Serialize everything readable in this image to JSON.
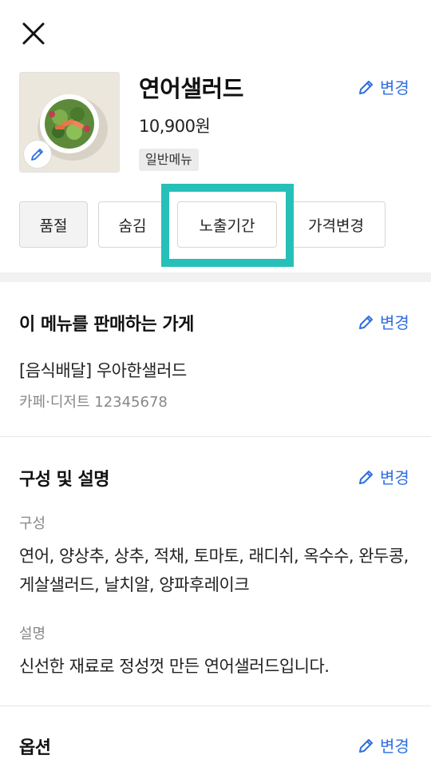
{
  "header": {
    "menu_name": "연어샐러드",
    "price": "10,900원",
    "tag": "일반메뉴",
    "edit_label": "변경"
  },
  "actions": [
    {
      "label": "품절"
    },
    {
      "label": "숨김"
    },
    {
      "label": "노출기간",
      "highlighted": true
    },
    {
      "label": "가격변경"
    }
  ],
  "stores_section": {
    "title": "이 메뉴를 판매하는 가게",
    "edit_label": "변경",
    "store_name": "[음식배달] 우아한샐러드",
    "store_meta": "카페·디저트 12345678"
  },
  "composition_section": {
    "title": "구성 및 설명",
    "edit_label": "변경",
    "composition_label": "구성",
    "composition_text": "연어, 양상추, 상추, 적채, 토마토, 래디쉬, 옥수수, 완두콩, 게살샐러드, 날치알, 양파후레이크",
    "description_label": "설명",
    "description_text": "신선한 재료로 정성껏 만든 연어샐러드입니다."
  },
  "options_section": {
    "title": "옵션",
    "edit_label": "변경"
  },
  "colors": {
    "accent_blue": "#2f6fe0",
    "highlight_teal": "#26c0b8"
  },
  "icons": {
    "close": "close-icon",
    "edit": "pencil-icon"
  }
}
